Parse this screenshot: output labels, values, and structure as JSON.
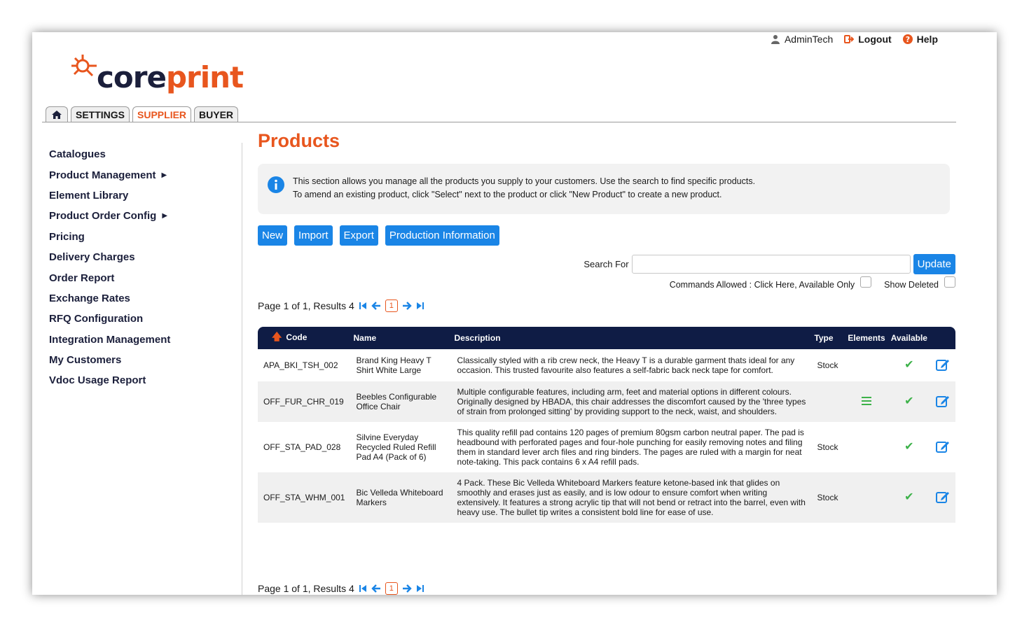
{
  "userbar": {
    "user": "AdminTech",
    "logout": "Logout",
    "help": "Help"
  },
  "logo": {
    "core": "core",
    "print": "print"
  },
  "tabs": [
    {
      "label": "SETTINGS"
    },
    {
      "label": "SUPPLIER"
    },
    {
      "label": "BUYER"
    }
  ],
  "sidebar": {
    "items": [
      {
        "label": "Catalogues"
      },
      {
        "label": "Product Management",
        "submenu": "▶"
      },
      {
        "label": "Element Library"
      },
      {
        "label": "Product Order Config",
        "submenu": "▶"
      },
      {
        "label": "Pricing"
      },
      {
        "label": "Delivery Charges"
      },
      {
        "label": "Order Report"
      },
      {
        "label": "Exchange Rates"
      },
      {
        "label": "RFQ Configuration"
      },
      {
        "label": "Integration Management"
      },
      {
        "label": "My Customers"
      },
      {
        "label": "Vdoc Usage Report"
      }
    ]
  },
  "main": {
    "title": "Products",
    "info_line1": "This section allows you manage all the products you supply to your customers. Use the search to find specific products.",
    "info_line2": "To amend an existing product, click \"Select\" next to the product or click \"New Product\" to create a new product.",
    "buttons": {
      "new": "New",
      "import": "Import",
      "export": "Export",
      "production": "Production Information"
    },
    "search": {
      "label": "Search For",
      "value": "",
      "placeholder": "",
      "update": "Update"
    },
    "options": {
      "commands": "Commands Allowed : Click Here, Available Only",
      "show_deleted": "Show Deleted"
    },
    "pager": {
      "text": "Page 1 of 1, Results 4",
      "current": "1"
    }
  },
  "table": {
    "headers": {
      "code": "Code",
      "name": "Name",
      "description": "Description",
      "type": "Type",
      "elements": "Elements",
      "available": "Available"
    },
    "rows": [
      {
        "code": "APA_BKI_TSH_002",
        "name": "Brand King Heavy T Shirt White Large",
        "description": "Classically styled with a rib crew neck, the Heavy T is a durable garment thats ideal for any occasion. This trusted favourite also features a self-fabric back neck tape for comfort.",
        "type": "Stock",
        "available": "✔"
      },
      {
        "code": "OFF_FUR_CHR_019",
        "name": "Beebles Configurable Office Chair",
        "description": "Multiple configurable features, including arm, feet and material options in different colours. Originally designed by HBADA, this chair addresses the discomfort caused by the 'three types of strain from prolonged sitting' by providing support to the neck, waist, and shoulders.",
        "type": "",
        "available": "✔"
      },
      {
        "code": "OFF_STA_PAD_028",
        "name": "Silvine Everyday Recycled Ruled Refill Pad A4 (Pack of 6)",
        "description": "This quality refill pad contains 120 pages of premium 80gsm carbon neutral paper. The pad is headbound with perforated pages and four-hole punching for easily removing notes and filing them in standard lever arch files and ring binders. The pages are ruled with a margin for neat note-taking. This pack contains 6 x A4 refill pads.",
        "type": "Stock",
        "available": "✔"
      },
      {
        "code": "OFF_STA_WHM_001",
        "name": "Bic Velleda Whiteboard Markers",
        "description": "4 Pack. These Bic Velleda Whiteboard Markers feature ketone-based ink that glides on smoothly and erases just as easily, and is low odour to ensure comfort when writing extensively. It features a strong acrylic tip that will not bend or retract into the barrel, even with heavy use. The bullet tip writes a consistent bold line for ease of use.",
        "type": "Stock",
        "available": "✔"
      }
    ]
  },
  "colors": {
    "accent": "#e8561e",
    "button": "#1a85e6",
    "header": "#0f1c45",
    "nav": "#1b1f3b",
    "tick": "#3db24a"
  }
}
